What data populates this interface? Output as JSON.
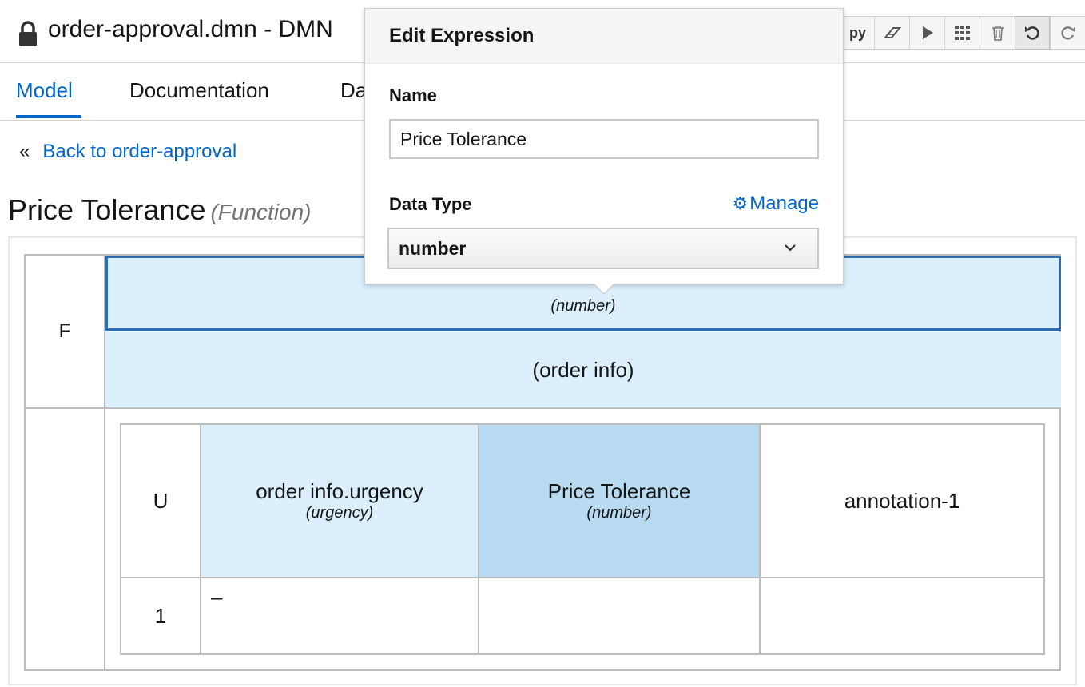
{
  "header": {
    "title": "order-approval.dmn - DMN",
    "toolbar": {
      "copy_label": "py",
      "icons": [
        "eraser-icon",
        "play-icon",
        "grid-icon",
        "trash-icon",
        "undo-icon",
        "redo-icon"
      ]
    }
  },
  "tabs": [
    {
      "label": "Model"
    },
    {
      "label": "Documentation"
    },
    {
      "label": "Da"
    }
  ],
  "back_link": "Back to order-approval",
  "heading": {
    "name": "Price Tolerance",
    "kind": "(Function)"
  },
  "function": {
    "kind_label": "F",
    "signature_type": "(number)",
    "parameters": "(order info)"
  },
  "decision_table": {
    "hit_policy": "U",
    "input": {
      "name": "order info.urgency",
      "type": "(urgency)"
    },
    "output": {
      "name": "Price Tolerance",
      "type": "(number)"
    },
    "annotation": "annotation-1",
    "rows": [
      {
        "number": "1",
        "input": "–",
        "output": "",
        "annotation": ""
      }
    ]
  },
  "popover": {
    "title": "Edit Expression",
    "name_label": "Name",
    "name_value": "Price Tolerance",
    "data_type_label": "Data Type",
    "manage_label": "Manage",
    "data_type_value": "number"
  },
  "colors": {
    "accent": "#0066cc",
    "header_cell_bg": "#dbeffc",
    "selected_cell_bg": "#b8dbf1",
    "selected_border": "#2a6db6"
  }
}
